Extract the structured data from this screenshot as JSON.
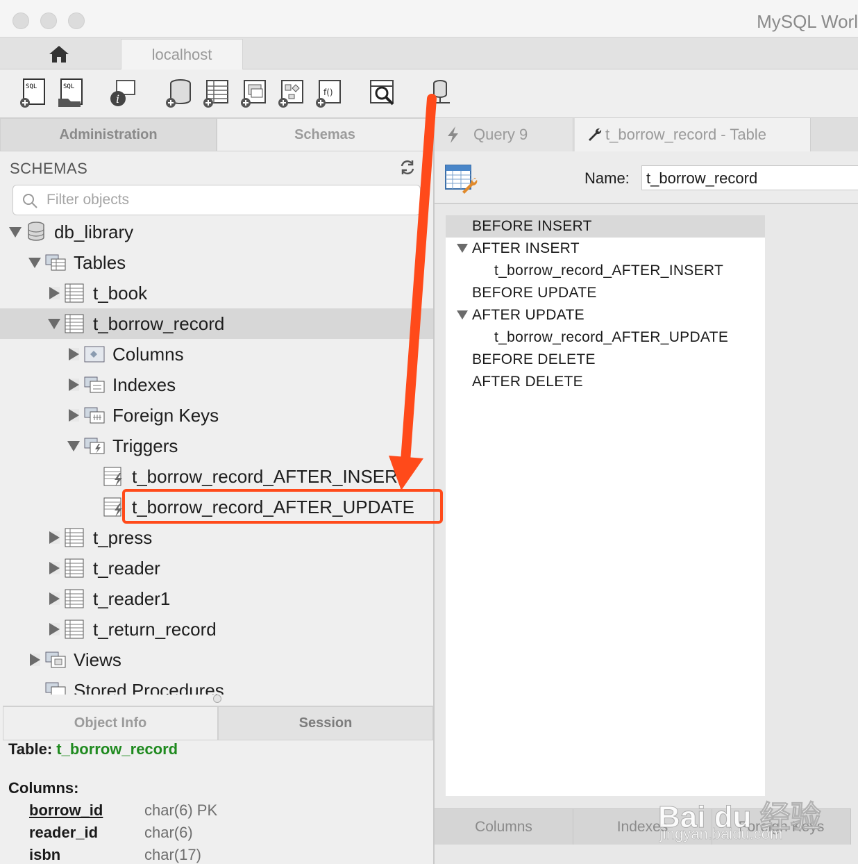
{
  "window": {
    "title": "MySQL Worl"
  },
  "tabs": {
    "connection": "localhost"
  },
  "left_tabs": {
    "administration": "Administration",
    "schemas": "Schemas"
  },
  "schemas": {
    "heading": "SCHEMAS",
    "filter_placeholder": "Filter objects",
    "tree": {
      "db": "db_library",
      "tables": "Tables",
      "t_book": "t_book",
      "t_borrow_record": "t_borrow_record",
      "columns": "Columns",
      "indexes": "Indexes",
      "foreign_keys": "Foreign Keys",
      "triggers": "Triggers",
      "trigger_1": "t_borrow_record_AFTER_INSER",
      "trigger_2": "t_borrow_record_AFTER_UPDATE",
      "t_press": "t_press",
      "t_reader": "t_reader",
      "t_reader1": "t_reader1",
      "t_return_record": "t_return_record",
      "views": "Views",
      "stored_procedures": "Stored Procedures"
    }
  },
  "info_tabs": {
    "object_info": "Object Info",
    "session": "Session"
  },
  "object_info": {
    "table_label": "Table:",
    "table_name": "t_borrow_record",
    "columns_label": "Columns:",
    "columns": [
      {
        "name": "borrow_id",
        "type": "char(6) PK"
      },
      {
        "name": "reader_id",
        "type": "char(6)"
      },
      {
        "name": "isbn",
        "type": "char(17)"
      }
    ]
  },
  "editor_tabs": {
    "query": "Query 9",
    "table": "t_borrow_record - Table"
  },
  "editor": {
    "name_label": "Name:",
    "name_value": "t_borrow_record",
    "trigger_rows": [
      "BEFORE INSERT",
      "AFTER INSERT",
      "t_borrow_record_AFTER_INSERT",
      "BEFORE UPDATE",
      "AFTER UPDATE",
      "t_borrow_record_AFTER_UPDATE",
      "BEFORE DELETE",
      "AFTER DELETE"
    ],
    "bottom_tabs": [
      "Columns",
      "Indexes",
      "Foreign Keys"
    ]
  },
  "watermark": {
    "brand": "Bai du 经验",
    "url": "jingyan.baidu.com"
  },
  "colors": {
    "highlight": "#ff4a1a",
    "table_name": "#1f8a1f",
    "selected_row": "#d7d7d7"
  }
}
